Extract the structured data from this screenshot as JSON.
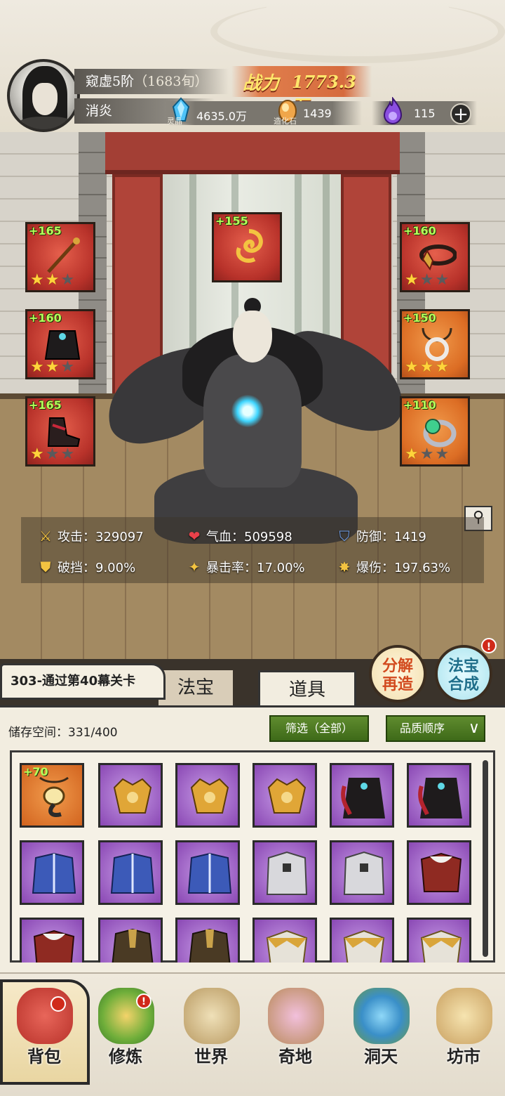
{
  "player": {
    "realm": "窥虚5阶",
    "age": "（1683旬）",
    "name": "消炎"
  },
  "power": {
    "label": "战力",
    "value": "1773.3万"
  },
  "resources": [
    {
      "icon": "spirit-crystal-icon",
      "caption": "灵晶",
      "value": "4635.0万"
    },
    {
      "icon": "creation-stone-icon",
      "caption": "造化石",
      "value": "1439"
    },
    {
      "icon": "purple-flame-icon",
      "caption": "",
      "value": "115"
    }
  ],
  "equipment": {
    "weapon": {
      "level": "+165",
      "stars": 2
    },
    "talisman": {
      "level": "+155"
    },
    "headband": {
      "level": "+160",
      "stars": 1
    },
    "robe": {
      "level": "+160",
      "stars": 2
    },
    "necklace": {
      "level": "+150",
      "stars": 3
    },
    "boots": {
      "level": "+165",
      "stars": 1
    },
    "ring": {
      "level": "+110",
      "stars": 1
    }
  },
  "stats": {
    "attack": "攻击：329097",
    "hp": "气血：509598",
    "defense": "防御：1419",
    "pierce": "破挡：9.00%",
    "crit_rate": "暴击率：17.00%",
    "crit_damage": "爆伤：197.63%"
  },
  "quest": "303-通过第40幕关卡",
  "tabs": {
    "fabao": "法宝",
    "daoju": "道具"
  },
  "buttons": {
    "decompose_1": "分解",
    "decompose_2": "再造",
    "merge_1": "法宝",
    "merge_2": "合成",
    "badge": "!"
  },
  "inventory": {
    "storage": "储存空间：331/400",
    "filter": "筛选（全部）",
    "sort": "品质顺序",
    "first_item_level": "+70"
  },
  "nav": [
    {
      "label": "背包"
    },
    {
      "label": "修炼"
    },
    {
      "label": "世界"
    },
    {
      "label": "奇地"
    },
    {
      "label": "洞天"
    },
    {
      "label": "坊市"
    }
  ],
  "colors": {
    "rarity_red": "#b8322a",
    "rarity_orange": "#dc6d24",
    "rarity_purple": "#8a48b4",
    "level_green": "#b6ff5a",
    "power_gold": "#ffe66b",
    "filter_green": "#4a7a22"
  }
}
